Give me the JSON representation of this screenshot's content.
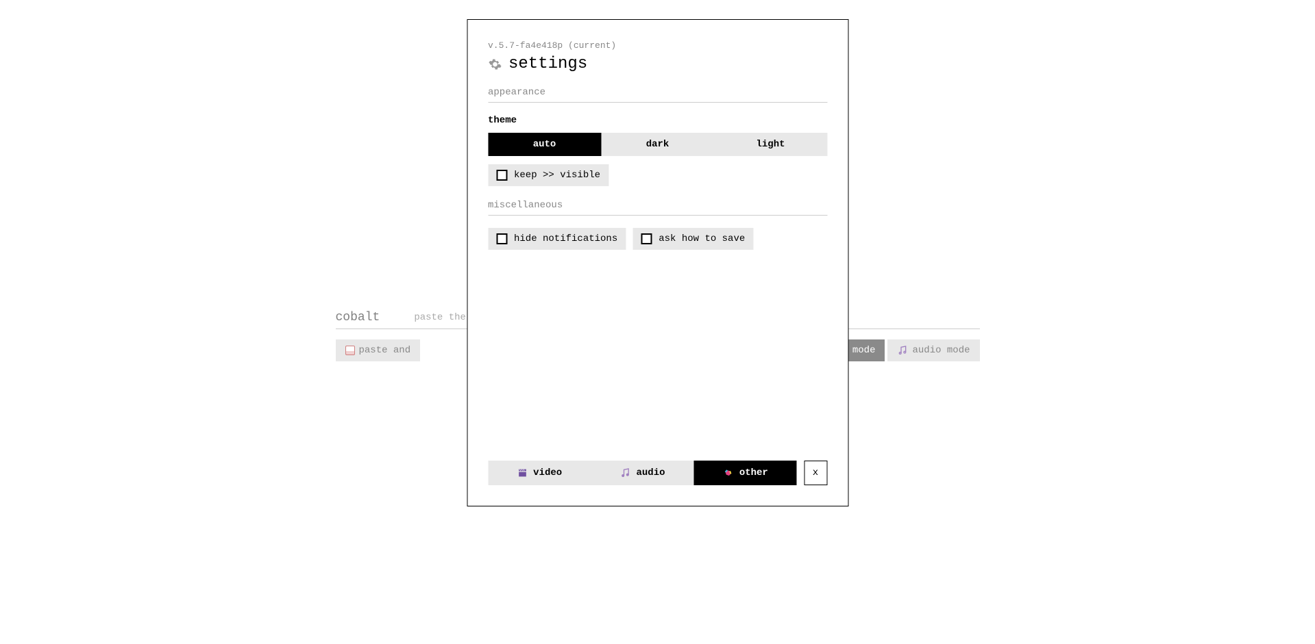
{
  "app": {
    "logo": "cobalt",
    "input_placeholder": "paste the link",
    "paste_button": "paste and",
    "modes": {
      "auto": "auto mode",
      "audio": "audio mode"
    }
  },
  "modal": {
    "version": "v.5.7-fa4e418p (current)",
    "title": "settings",
    "sections": {
      "appearance": {
        "header": "appearance",
        "theme_label": "theme",
        "theme_options": {
          "auto": "auto",
          "dark": "dark",
          "light": "light"
        },
        "keep_visible": "keep >> visible"
      },
      "misc": {
        "header": "miscellaneous",
        "hide_notifications": "hide notifications",
        "ask_how_save": "ask how to save"
      }
    },
    "tabs": {
      "video": "video",
      "audio": "audio",
      "other": "other"
    },
    "close": "x"
  }
}
